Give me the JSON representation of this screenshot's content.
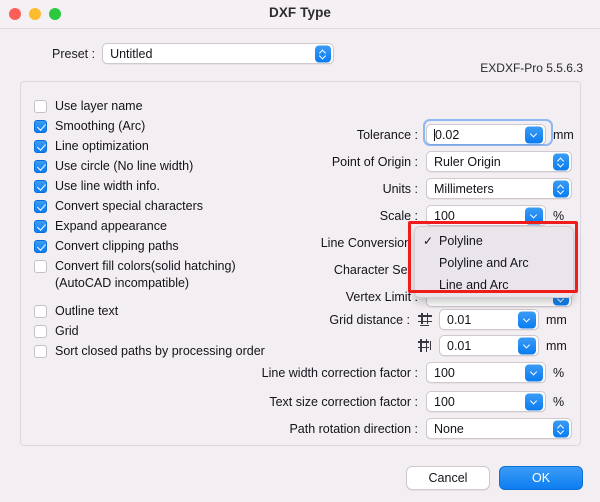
{
  "window": {
    "title": "DXF Type",
    "traffic_lights": [
      "close-button",
      "minimize-button",
      "zoom-button"
    ]
  },
  "preset": {
    "label": "Preset :",
    "value": "Untitled"
  },
  "version": "EXDXF-Pro 5.5.6.3",
  "checkboxes": [
    {
      "label": "Use layer name",
      "checked": false
    },
    {
      "label": "Smoothing (Arc)",
      "checked": true
    },
    {
      "label": "Line optimization",
      "checked": true
    },
    {
      "label": "Use circle (No line width)",
      "checked": true
    },
    {
      "label": "Use line width info.",
      "checked": true
    },
    {
      "label": "Convert special characters",
      "checked": true
    },
    {
      "label": "Expand appearance",
      "checked": true
    },
    {
      "label": "Convert clipping paths",
      "checked": true
    },
    {
      "label": "Convert fill colors(solid hatching)\n(AutoCAD incompatible)",
      "checked": false
    },
    {
      "label": "Outline text",
      "checked": false
    },
    {
      "label": "Grid",
      "checked": false
    },
    {
      "label": "Sort closed paths by processing order",
      "checked": false
    }
  ],
  "fields": {
    "tolerance": {
      "label": "Tolerance :",
      "value": "0.02",
      "unit": "mm",
      "focused": true
    },
    "point_of_origin": {
      "label": "Point of Origin :",
      "value": "Ruler Origin",
      "unit": ""
    },
    "units": {
      "label": "Units :",
      "value": "Millimeters",
      "unit": ""
    },
    "scale": {
      "label": "Scale :",
      "value": "100",
      "unit": "%"
    },
    "line_conversion": {
      "label": "Line Conversion :",
      "value": "Polyline",
      "unit": ""
    },
    "character_set": {
      "label": "Character Set :",
      "value": "",
      "unit": ""
    },
    "vertex_limit": {
      "label": "Vertex Limit :",
      "value": "",
      "unit": ""
    },
    "grid_distance_h": {
      "label": "Grid distance :",
      "value": "0.01",
      "unit": "mm"
    },
    "grid_distance_v": {
      "label": "",
      "value": "0.01",
      "unit": "mm"
    },
    "line_width_correction": {
      "label": "Line width correction factor :",
      "value": "100",
      "unit": "%"
    },
    "text_size_correction": {
      "label": "Text size correction factor :",
      "value": "100",
      "unit": "%"
    },
    "path_rotation": {
      "label": "Path rotation direction :",
      "value": "None",
      "unit": ""
    }
  },
  "line_conversion_menu": {
    "items": [
      {
        "label": "Polyline",
        "selected": true
      },
      {
        "label": "Polyline and Arc",
        "selected": false
      },
      {
        "label": "Line and Arc",
        "selected": false
      }
    ],
    "checkmark": "✓",
    "highlight_color": "#ef1c1c"
  },
  "footer": {
    "cancel_label": "Cancel",
    "ok_label": "OK"
  }
}
